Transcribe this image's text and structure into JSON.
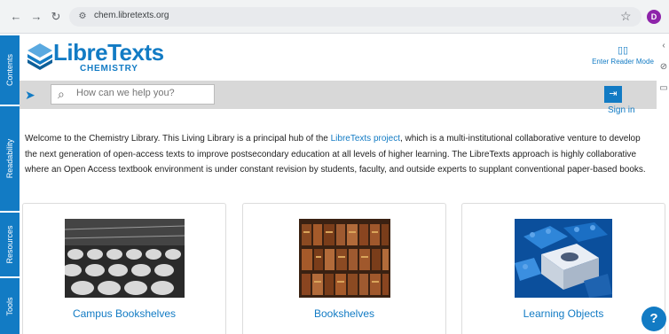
{
  "browser": {
    "url": "chem.libretexts.org",
    "back_icon": "back-arrow-icon",
    "forward_icon": "forward-arrow-icon",
    "reload_icon": "reload-icon",
    "profile_initial": "D",
    "profile_color": "#8e24aa"
  },
  "sidebar": {
    "tabs": [
      {
        "label": "Contents"
      },
      {
        "label": "Readability"
      },
      {
        "label": "Resources"
      },
      {
        "label": "Tools"
      }
    ],
    "color": "#127bc4"
  },
  "header": {
    "logo_text": "LibreTexts",
    "logo_sub": "CHEMISTRY",
    "reader_label": "Enter Reader Mode"
  },
  "search": {
    "placeholder": "How can we help you?"
  },
  "account": {
    "signin_label": "Sign in"
  },
  "intro": {
    "before_link": "Welcome to the Chemistry Library. This Living Library is a principal hub of the ",
    "link_text": "LibreTexts project",
    "after_link": ", which is a multi-institutional collaborative venture to develop the next generation of open-access texts to improve postsecondary education at all levels of higher learning. The LibreTexts approach is highly collaborative where an Open Access textbook environment is under constant revision by students, faculty, and outside experts to supplant conventional paper-based books."
  },
  "cards": [
    {
      "title": "Campus Bookshelves"
    },
    {
      "title": "Bookshelves"
    },
    {
      "title": "Learning Objects"
    }
  ],
  "help": {
    "label": "?"
  },
  "colors": {
    "accent": "#127bc4",
    "search_bar": "#d8d8d8"
  }
}
